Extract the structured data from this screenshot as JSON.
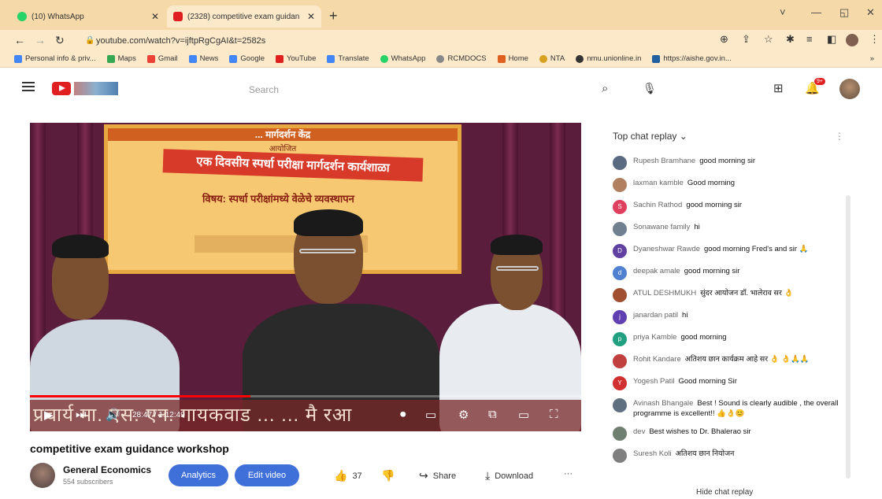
{
  "browser": {
    "tabs": [
      {
        "label": "(10) WhatsApp",
        "color": "#25d366"
      },
      {
        "label": "(2328) competitive exam guidan",
        "color": "#e02020"
      }
    ],
    "new_tab": "+",
    "url": "youtube.com/watch?v=ijftpRgCgAI&t=2582s",
    "window_controls": [
      "˅",
      "—",
      "◱",
      "✕"
    ],
    "bookmarks": [
      {
        "label": "Personal info & priv...",
        "color": "#4285f4"
      },
      {
        "label": "Maps",
        "color": "#34a853"
      },
      {
        "label": "Gmail",
        "color": "#ea4335"
      },
      {
        "label": "News",
        "color": "#4285f4"
      },
      {
        "label": "Google",
        "color": "#4285f4"
      },
      {
        "label": "YouTube",
        "color": "#e02020"
      },
      {
        "label": "Translate",
        "color": "#4285f4"
      },
      {
        "label": "WhatsApp",
        "color": "#25d366"
      },
      {
        "label": "RCMDOCS",
        "color": "#888888"
      },
      {
        "label": "Home",
        "color": "#e06020"
      },
      {
        "label": "NTA",
        "color": "#d8a020"
      },
      {
        "label": "nmu.unionline.in",
        "color": "#333333"
      },
      {
        "label": "https://aishe.gov.in...",
        "color": "#2060a0"
      }
    ],
    "bookmarks_more": "»"
  },
  "youtube": {
    "search_placeholder": "Search",
    "notification_count": "9+"
  },
  "video": {
    "banner_top": "... मार्गदर्शन केंद्र",
    "banner_sub": "आयोजित",
    "banner_title": "एक दिवसीय स्पर्धा परीक्षा मार्गदर्शन कार्यशाळा",
    "banner_subject": "विषय: स्पर्धा परीक्षांमध्ये वेळेचे व्यवस्थापन",
    "overlay": "प्रचार्य मा. एस. एन. गायकवाड ... ... मै रआ",
    "time": "28:47 / 1:12:49",
    "progress_fraction": 0.4,
    "title": "competitive exam guidance workshop",
    "channel": "General Economics",
    "subscribers": "554 subscribers",
    "analytics_label": "Analytics",
    "edit_label": "Edit video",
    "likes": "37",
    "share_label": "Share",
    "download_label": "Download",
    "more_label": "···"
  },
  "chat": {
    "header": "Top chat replay",
    "hide_label": "Hide chat replay",
    "messages": [
      {
        "author": "Rupesh Bramhane",
        "text": "good morning sir",
        "avatar": "",
        "color": "#5a6a80"
      },
      {
        "author": "laxman kamble",
        "text": "Good morning",
        "avatar": "",
        "color": "#b08060"
      },
      {
        "author": "Sachin Rathod",
        "text": "good morning sir",
        "avatar": "S",
        "color": "#e04060"
      },
      {
        "author": "Sonawane family",
        "text": "hi",
        "avatar": "",
        "color": "#708090"
      },
      {
        "author": "Dyaneshwar Rawde",
        "text": "good morning Fred's and sir 🙏",
        "avatar": "D",
        "color": "#6040a0"
      },
      {
        "author": "deepak amale",
        "text": "good morning sir",
        "avatar": "d",
        "color": "#5080d0"
      },
      {
        "author": "ATUL DESHMUKH",
        "text": "सुंदर आयोजन डॉ. भालेराव सर 👌",
        "avatar": "",
        "color": "#a05030"
      },
      {
        "author": "janardan patil",
        "text": "hi",
        "avatar": "j",
        "color": "#6040b0"
      },
      {
        "author": "priya Kamble",
        "text": "good morning",
        "avatar": "p",
        "color": "#20a080"
      },
      {
        "author": "Rohit Kandare",
        "text": "अतिशय छान कार्यक्रम आहे सर 👌 👌🙏🙏",
        "avatar": "",
        "color": "#c04040"
      },
      {
        "author": "Yogesh Patil",
        "text": "Good morning Sir",
        "avatar": "Y",
        "color": "#d03030"
      },
      {
        "author": "Avinash Bhangale",
        "text": "Best ! Sound is clearly audible , the overall programme is excellent!! 👍👌😊",
        "avatar": "",
        "color": "#607080"
      },
      {
        "author": "dev",
        "text": "Best wishes to Dr. Bhalerao sir",
        "avatar": "",
        "color": "#708070"
      },
      {
        "author": "Suresh Koli",
        "text": "अतिशय छान नियोजन",
        "avatar": "",
        "color": "#808080"
      }
    ]
  }
}
